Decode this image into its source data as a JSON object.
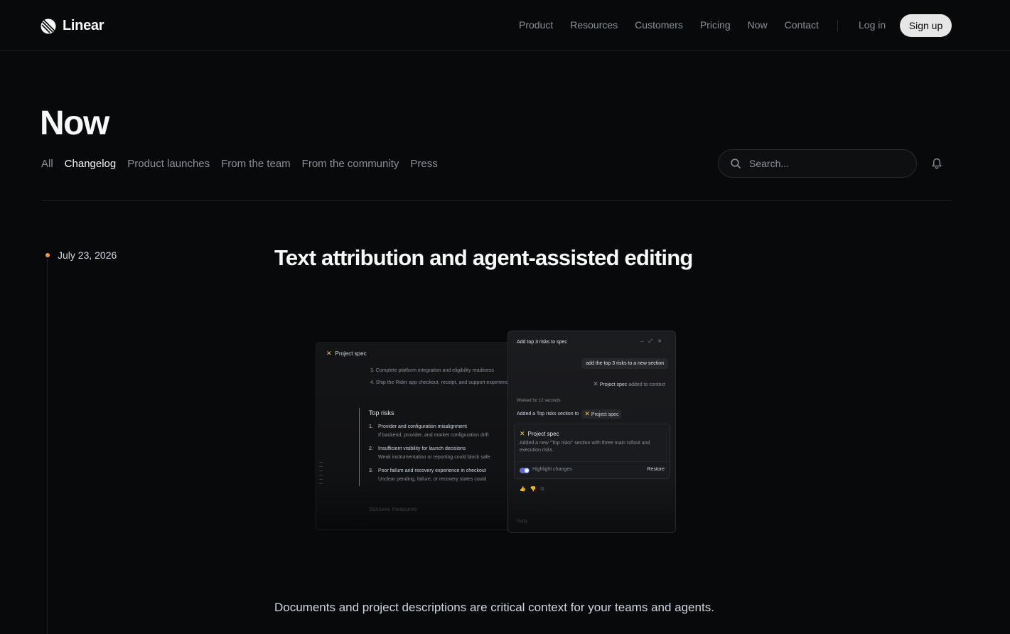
{
  "header": {
    "logo_text": "Linear",
    "nav": [
      "Product",
      "Resources",
      "Customers",
      "Pricing",
      "Now",
      "Contact"
    ],
    "login": "Log in",
    "signup": "Sign up"
  },
  "page": {
    "title": "Now",
    "filters": [
      "All",
      "Changelog",
      "Product launches",
      "From the team",
      "From the community",
      "Press"
    ],
    "active_filter": "Changelog",
    "search_placeholder": "Search..."
  },
  "entry": {
    "date": "July 23, 2026",
    "title": "Text attribution and agent-assisted editing",
    "body": "Documents and project descriptions are critical context for your teams and agents."
  },
  "illustration": {
    "doc": {
      "title": "Project spec",
      "lines": [
        "3.   Complete platform integration and eligibility readiness",
        "4.   Ship the Rider app checkout, receipt, and support experience"
      ],
      "section": "Top risks",
      "items": [
        {
          "n": "1.",
          "title": "Provider and configuration misalignment",
          "sub": "If backend, provider, and market configuration drift"
        },
        {
          "n": "2.",
          "title": "Insufficient visibility for launch decisions",
          "sub": "Weak instrumentation or reporting could block safe"
        },
        {
          "n": "3.",
          "title": "Poor failure and recovery experience in checkout",
          "sub": "Unclear pending, failure, or recovery states could"
        }
      ],
      "footer_section": "Success measures"
    },
    "chat": {
      "title": "Add top 3 risks to spec",
      "user_message": "add the top 3 risks to a new section",
      "context_doc": "Project spec",
      "context_suffix": "added to context",
      "worked": "Worked for 12 seconds",
      "added_prefix": "Added a Top risks section to",
      "added_doc": "Project spec",
      "card_title": "Project spec",
      "card_desc": "Added a new \"Top risks\" section with three main rollout and execution risks.",
      "highlight": "Highlight changes",
      "restore": "Restore",
      "reply": "Reply"
    }
  },
  "colors": {
    "background": "#08090a",
    "accent": "#5e6ad2",
    "timeline_dot": "#f2994a",
    "project_icon": "#f2c94c"
  }
}
